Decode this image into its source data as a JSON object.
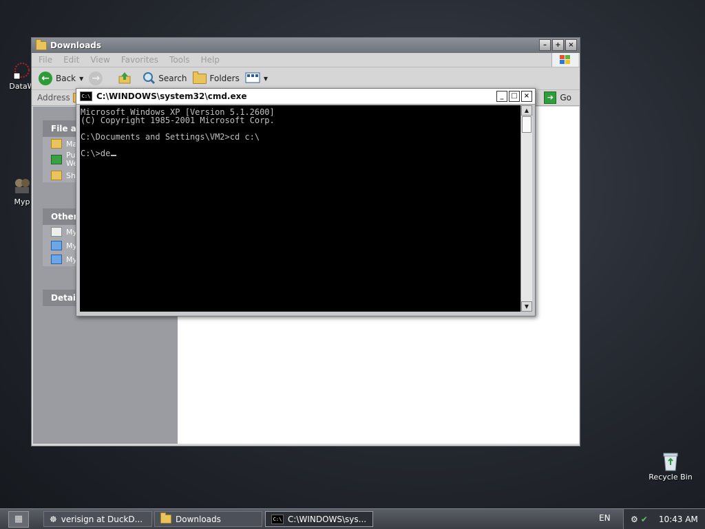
{
  "desktop": {
    "icons": [
      {
        "label": "DataW",
        "icon": "datawatch-icon"
      },
      {
        "label": "Myp",
        "icon": "myp-icon"
      },
      {
        "label": "Recycle Bin",
        "icon": "recycle-bin-icon"
      }
    ]
  },
  "explorer": {
    "title": "Downloads",
    "menu": [
      "File",
      "Edit",
      "View",
      "Favorites",
      "Tools",
      "Help"
    ],
    "toolbar": {
      "back": "Back",
      "search": "Search",
      "folders": "Folders"
    },
    "address_label": "Address",
    "go_label": "Go",
    "tasks": {
      "file_header": "File an",
      "file_items": [
        "Ma",
        "Pu",
        "We",
        "Sh"
      ],
      "other_header": "Other",
      "other_items": [
        "My",
        "My",
        "My"
      ],
      "details_header": "Details"
    }
  },
  "cmd": {
    "title": "C:\\WINDOWS\\system32\\cmd.exe",
    "icon_text": "C:\\",
    "lines": [
      "Microsoft Windows XP [Version 5.1.2600]",
      "(C) Copyright 1985-2001 Microsoft Corp.",
      "",
      "C:\\Documents and Settings\\VM2>cd c:\\",
      "",
      "C:\\>de"
    ]
  },
  "taskbar": {
    "tasks": [
      {
        "label": "verisign at DuckD...",
        "icon": "browser-icon"
      },
      {
        "label": "Downloads",
        "icon": "folder-icon"
      },
      {
        "label": "C:\\WINDOWS\\sys...",
        "icon": "cmd-icon",
        "active": true
      }
    ],
    "language": "EN",
    "clock": "10:43 AM"
  }
}
